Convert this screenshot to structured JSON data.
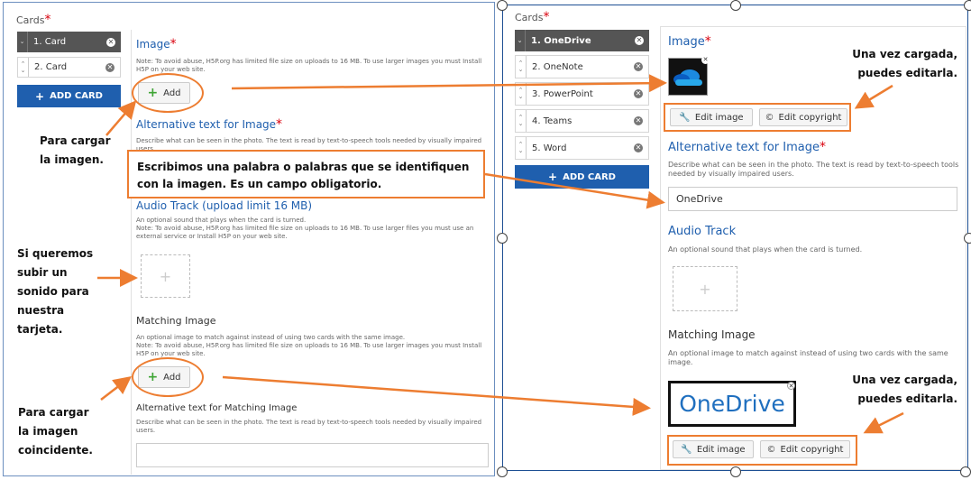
{
  "left": {
    "cards_label": "Cards",
    "cards": [
      {
        "label": "1. Card"
      },
      {
        "label": "2. Card"
      }
    ],
    "add_card": "ADD CARD",
    "image_title": "Image",
    "image_note": "Note: To avoid abuse, H5P.org has limited file size on uploads to 16 MB. To use larger images you must Install H5P on your web site.",
    "add_label": "Add",
    "alt_title": "Alternative text for Image",
    "alt_desc": "Describe what can be seen in the photo. The text is read by text-to-speech tools needed by visually impaired users.",
    "audio_title": "Audio Track (upload limit 16 MB)",
    "audio_desc": "An optional sound that plays when the card is turned.",
    "audio_note": "Note: To avoid abuse, H5P.org has limited file size on uploads to 16 MB. To use larger files you must use an external service or Install H5P on your web site.",
    "matching_title": "Matching Image",
    "matching_desc": "An optional image to match against instead of using two cards with the same image.",
    "matching_note": "Note: To avoid abuse, H5P.org has limited file size on uploads to 16 MB. To use larger images you must Install H5P on your web site.",
    "matching_alt_title": "Alternative text for Matching Image",
    "matching_alt_desc": "Describe what can be seen in the photo. The text is read by text-to-speech tools needed by visually impaired users."
  },
  "right": {
    "cards_label": "Cards",
    "cards": [
      {
        "label": "1. OneDrive"
      },
      {
        "label": "2. OneNote"
      },
      {
        "label": "3. PowerPoint"
      },
      {
        "label": "4. Teams"
      },
      {
        "label": "5. Word"
      }
    ],
    "add_card": "ADD CARD",
    "image_title": "Image",
    "edit_image": "Edit image",
    "edit_copyright": "Edit copyright",
    "alt_title": "Alternative text for Image",
    "alt_desc": "Describe what can be seen in the photo. The text is read by text-to-speech tools needed by visually impaired users.",
    "alt_value": "OneDrive",
    "audio_title": "Audio Track",
    "audio_desc": "An optional sound that plays when the card is turned.",
    "matching_title": "Matching Image",
    "matching_desc": "An optional image to match against instead of using two cards with the same image.",
    "matching_image_text": "OneDrive",
    "edit_image_2": "Edit image",
    "edit_copyright_2": "Edit copyright"
  },
  "annotations": {
    "upload_image": "Para cargar la imagen.",
    "callout": "Escribimos una palabra o palabras que se identifiquen con la imagen. Es un campo obligatorio.",
    "audio": "Si queremos subir un sonido para nuestra tarjeta.",
    "matching": "Para cargar la imagen coincidente.",
    "loaded_1": "Una vez cargada, puedes editarla.",
    "loaded_2": "Una vez cargada, puedes editarla."
  },
  "colors": {
    "accent": "#ed7d31",
    "brand": "#1f5fae",
    "required": "#d9000d",
    "active_card": "#555555"
  }
}
